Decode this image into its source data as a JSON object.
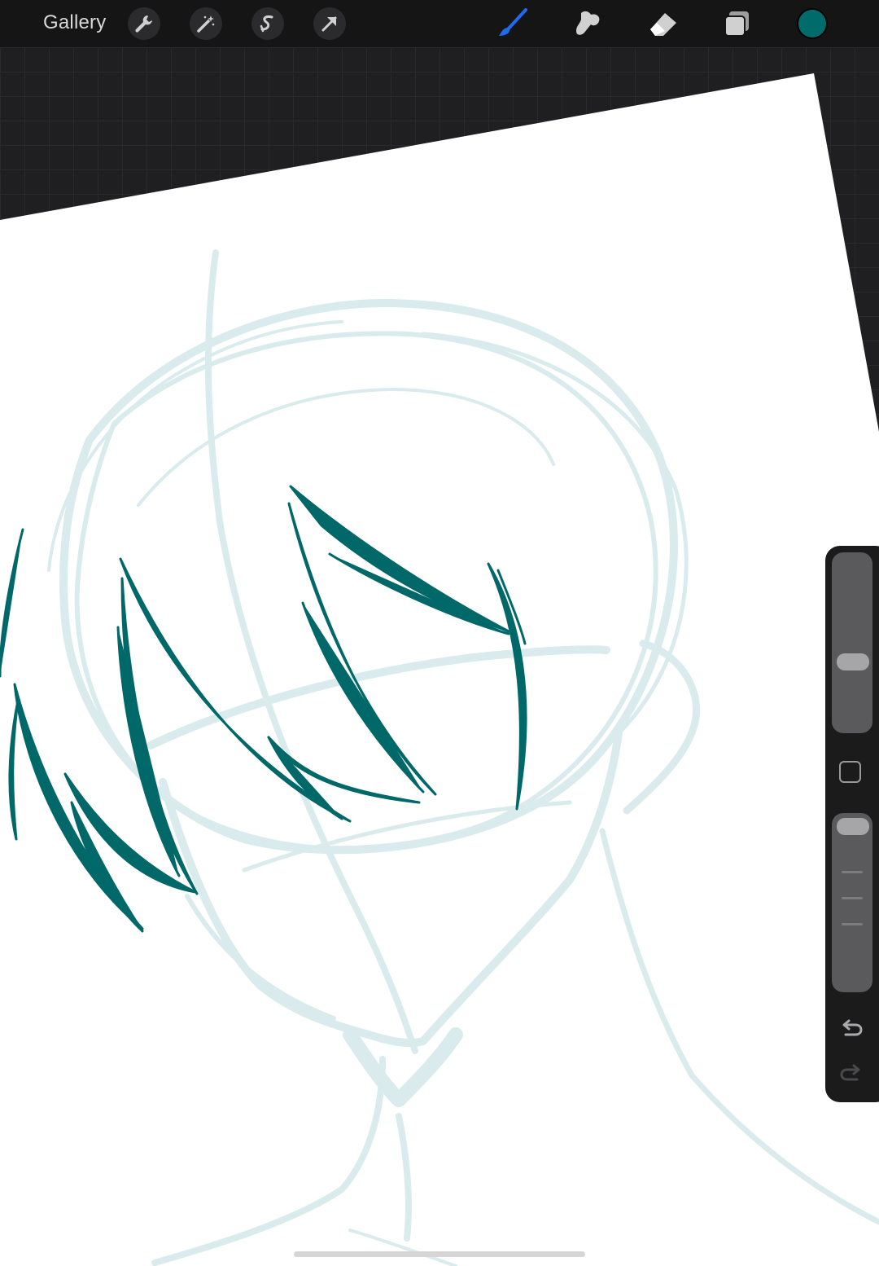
{
  "toolbar": {
    "gallery_label": "Gallery",
    "left_tools": [
      "wrench-icon",
      "magic-wand-icon",
      "selection-icon",
      "transform-arrow-icon"
    ],
    "right_tools": [
      "brush-icon",
      "smudge-icon",
      "eraser-icon",
      "layers-icon"
    ],
    "active_tool": "brush-icon",
    "active_color": "#006b6b"
  },
  "colors": {
    "sketch_light": "#d9ebec",
    "line_art": "#006868",
    "brush_active": "#1e6bf0",
    "canvas": "#ffffff"
  },
  "sidebar": {
    "brush_size_level": 0.5,
    "opacity_level": 1.0,
    "undo_icon": "undo-icon",
    "redo_icon": "redo-icon"
  }
}
